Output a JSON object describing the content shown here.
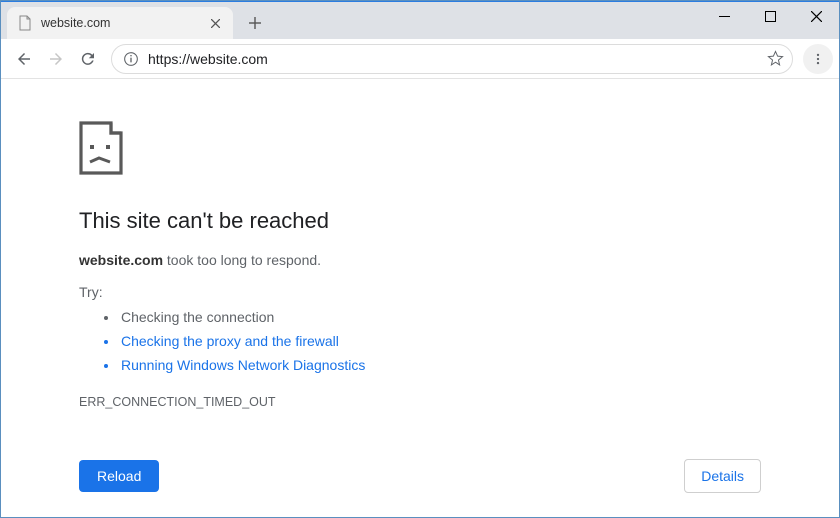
{
  "tab": {
    "title": "website.com"
  },
  "address_bar": {
    "scheme": "https://",
    "host": "website.com"
  },
  "error": {
    "heading": "This site can't be reached",
    "host": "website.com",
    "msg_suffix": " took too long to respond.",
    "try_label": "Try:",
    "suggestions": {
      "check_connection": "Checking the connection",
      "proxy_firewall": "Checking the proxy and the firewall",
      "diagnostics": "Running Windows Network Diagnostics"
    },
    "code": "ERR_CONNECTION_TIMED_OUT",
    "reload": "Reload",
    "details": "Details"
  }
}
